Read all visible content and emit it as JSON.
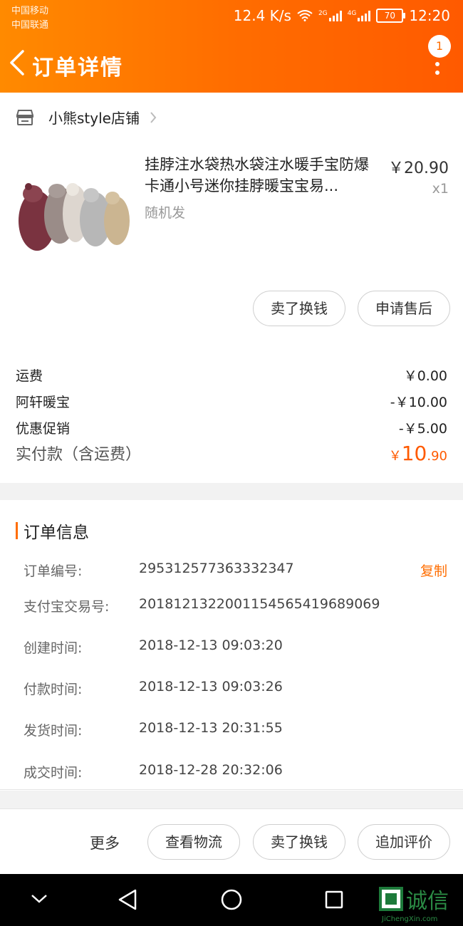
{
  "status_bar": {
    "carrier1": "中国移动",
    "carrier2": "中国联通",
    "speed": "12.4 K/s",
    "net1": "2G",
    "net2": "4G",
    "battery": "70",
    "time": "12:20"
  },
  "navbar": {
    "title": "订单详情",
    "badge": "1",
    "back_icon": "chevron-left-icon",
    "more_icon": "more-vertical-icon"
  },
  "shop": {
    "name": "小熊style店铺",
    "shop_icon": "store-icon"
  },
  "product": {
    "title": "挂脖注水袋热水袋注水暖手宝防爆卡通小号迷你挂脖暖宝宝易...",
    "price": "￥20.90",
    "qty": "x1",
    "sku": "随机发"
  },
  "product_actions": {
    "sell": "卖了换钱",
    "after_sale": "申请售后"
  },
  "fees": [
    {
      "label": "运费",
      "value": "￥0.00"
    },
    {
      "label": "阿轩暖宝",
      "value": "-￥10.00"
    },
    {
      "label": "优惠促销",
      "value": "-￥5.00"
    }
  ],
  "total": {
    "label": "实付款（含运费）",
    "symbol": "￥",
    "int": "10",
    "dec": ".90"
  },
  "order_info": {
    "title": "订单信息",
    "copy": "复制",
    "rows": [
      {
        "label": "订单编号:",
        "value": "295312577363332347"
      },
      {
        "label": "支付宝交易号:",
        "value": "2018121322001154565419689069"
      },
      {
        "label": "创建时间:",
        "value": "2018-12-13 09:03:20"
      },
      {
        "label": "付款时间:",
        "value": "2018-12-13 09:03:26"
      },
      {
        "label": "发货时间:",
        "value": "2018-12-13 20:31:55"
      },
      {
        "label": "成交时间:",
        "value": "2018-12-28 20:32:06"
      }
    ]
  },
  "bottom": {
    "more": "更多",
    "logistics": "查看物流",
    "sell": "卖了换钱",
    "review": "追加评价"
  },
  "colors": {
    "accent": "#ff6d00",
    "header_start": "#ff8a00",
    "header_end": "#ff5a00"
  },
  "watermark": {
    "text": "诚信",
    "sub": "JiChengXin.com"
  }
}
